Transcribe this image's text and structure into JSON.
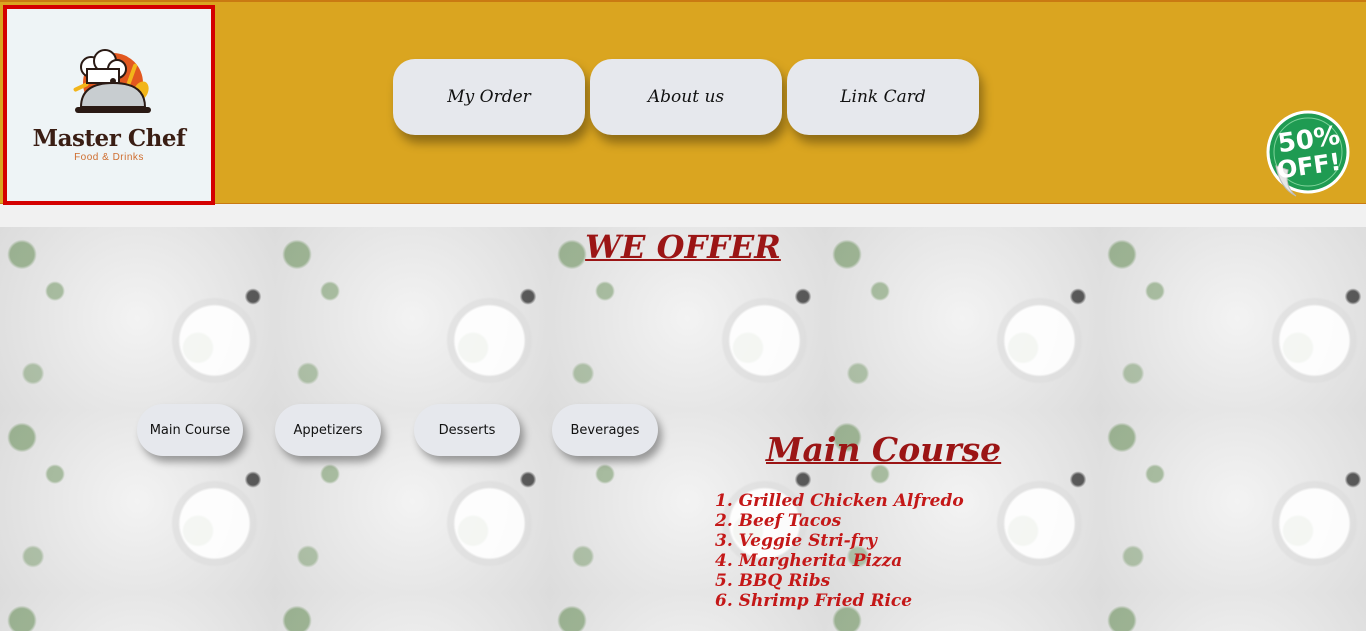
{
  "brand": {
    "name": "Master Chef",
    "tagline": "Food & Drinks"
  },
  "nav": {
    "items": [
      {
        "label": "My Order"
      },
      {
        "label": "About us"
      },
      {
        "label": "Link Card"
      }
    ]
  },
  "promo": {
    "line1": "50%",
    "line2": "OFF!",
    "color": "#1f9b52"
  },
  "offer": {
    "title": "WE OFFER"
  },
  "categories": [
    {
      "label": "Main Course"
    },
    {
      "label": "Appetizers"
    },
    {
      "label": "Desserts"
    },
    {
      "label": "Beverages"
    }
  ],
  "menu": {
    "title": "Main Course",
    "items": [
      "1. Grilled Chicken Alfredo",
      "2. Beef Tacos",
      "3. Veggie Stri-fry",
      "4. Margherita Pizza",
      "5. BBQ Ribs",
      "6. Shrimp Fried Rice"
    ]
  },
  "colors": {
    "header": "#daa520",
    "accent": "#9b1515",
    "logo_border": "#d40000"
  }
}
